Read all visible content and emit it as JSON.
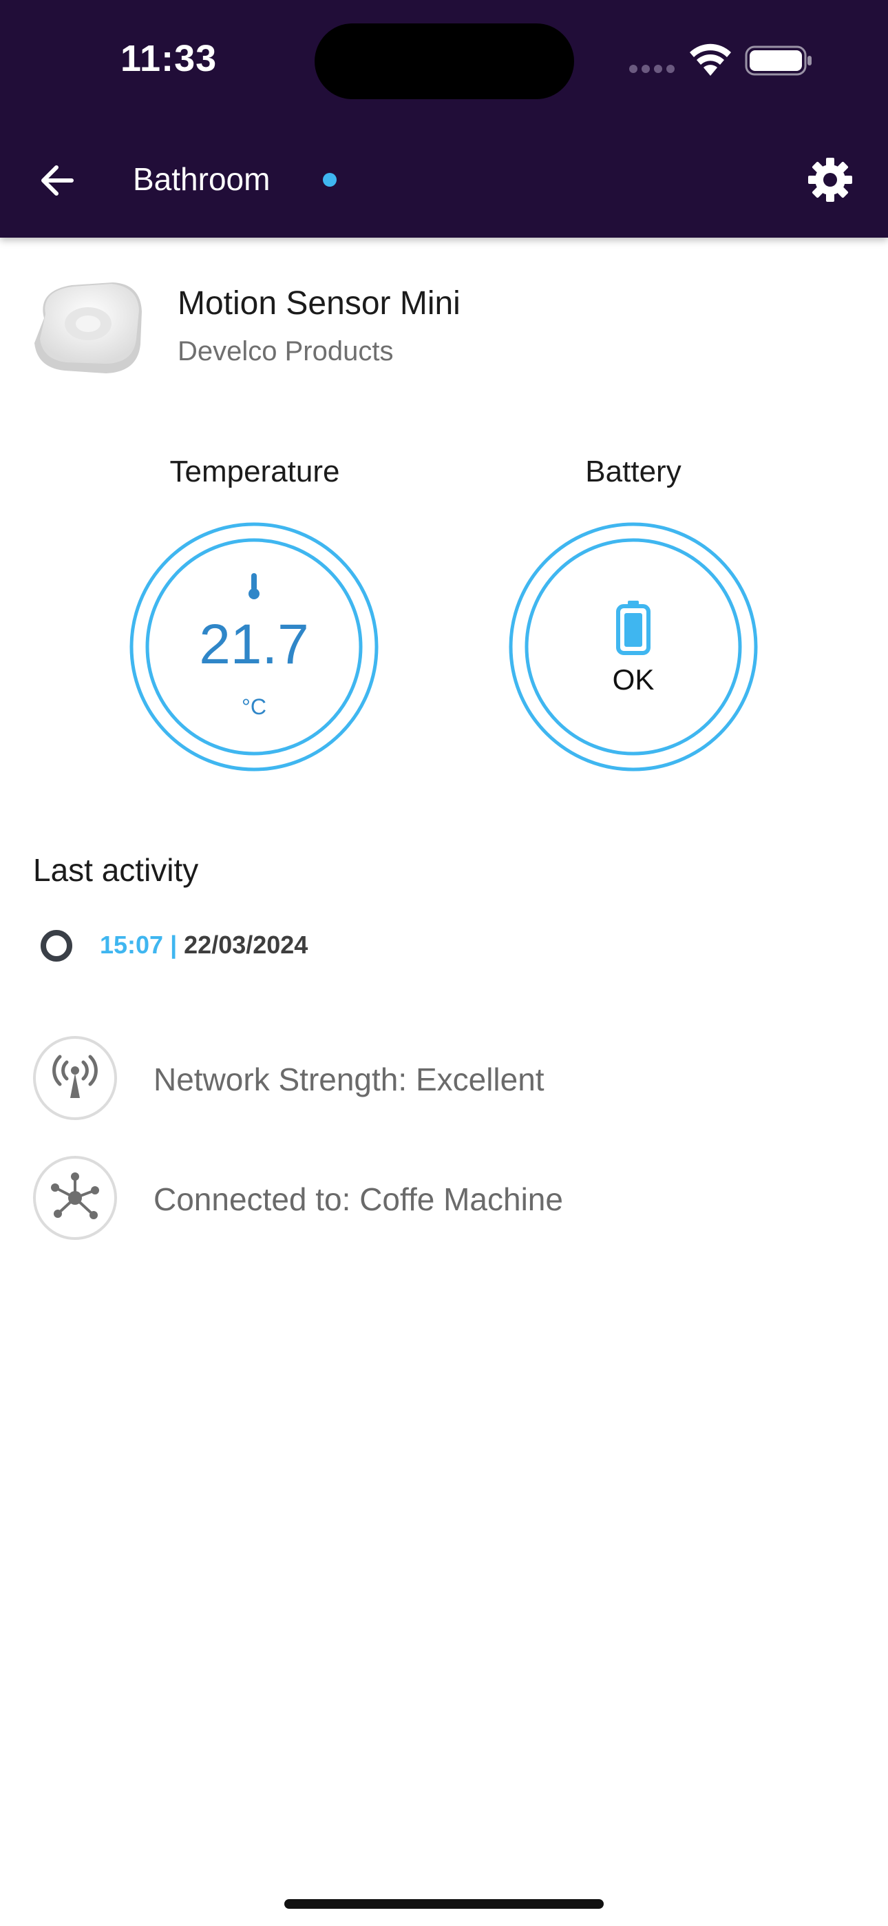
{
  "status_bar": {
    "time": "11:33",
    "icons": [
      "cellular-signal-icon",
      "wifi-icon",
      "battery-icon"
    ]
  },
  "header": {
    "title": "Bathroom",
    "back_icon": "back-arrow-icon",
    "settings_icon": "gear-icon",
    "status_dot_color": "#3fb6f0",
    "background_color": "#210d38"
  },
  "device": {
    "name": "Motion Sensor Mini",
    "brand": "Develco Products",
    "image": "motion-sensor-image"
  },
  "gauges": {
    "temperature": {
      "label": "Temperature",
      "value": "21.7",
      "unit": "°C",
      "icon": "thermometer-icon"
    },
    "battery": {
      "label": "Battery",
      "status": "OK",
      "icon": "battery-icon"
    },
    "ring_color": "#3fb6f0"
  },
  "last_activity": {
    "title": "Last activity",
    "time": "15:07",
    "separator": " | ",
    "date": "22/03/2024"
  },
  "info_rows": [
    {
      "icon": "antenna-signal-icon",
      "text": "Network Strength: Excellent"
    },
    {
      "icon": "network-hub-icon",
      "text": "Connected to: Coffe Machine"
    }
  ]
}
